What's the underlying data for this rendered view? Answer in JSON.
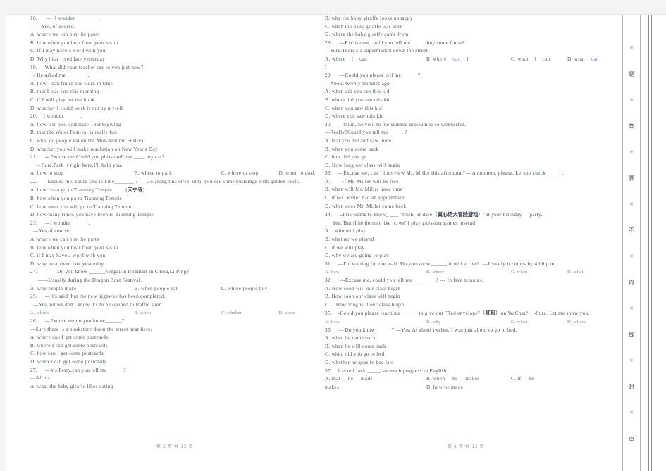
{
  "document": {
    "type": "scanned-exam-paper",
    "language": "en-zh",
    "left_page_footer": "第 3 页/共 12 页",
    "right_page_footer": "第 4 页/共 12 页"
  },
  "seal_strip": {
    "marks": [
      "※",
      "※",
      "※",
      "※",
      "※",
      "※",
      "※",
      "※"
    ],
    "characters": [
      "题",
      "答",
      "要",
      "不",
      "内",
      "线",
      "封",
      "密"
    ]
  },
  "left_page": {
    "lines": [
      {
        "kind": "q",
        "text": "18.      —  I wonder ________."
      },
      {
        "kind": "q",
        "text": "  —  Yes, of course."
      },
      {
        "kind": "opt",
        "text": "A. where we can buy the pants"
      },
      {
        "kind": "opt",
        "text": "B. how often you hear from your sister"
      },
      {
        "kind": "opt",
        "text": "C. If I may have a word with you"
      },
      {
        "kind": "opt",
        "text": "D. Why hear rived late yesterday"
      },
      {
        "kind": "q",
        "text": "19.     What did your teacher say to you just now?"
      },
      {
        "kind": "q",
        "text": "  - He asked me________."
      },
      {
        "kind": "opt",
        "text": "A. how I can finish the work in time"
      },
      {
        "kind": "opt",
        "text": "B. that I was late this morning"
      },
      {
        "kind": "opt",
        "text": "C. if I will play for the book"
      },
      {
        "kind": "opt",
        "text": "D. whether I could work it out by myself"
      },
      {
        "kind": "q",
        "text": "20.    I wonder______."
      },
      {
        "kind": "opt",
        "text": "A. how will you celebrate Thanksgiving"
      },
      {
        "kind": "opt",
        "text": "B. that the Water Festival is really fun."
      },
      {
        "kind": "opt",
        "text": "C. what do people eat on the Mid-Autumn Festival"
      },
      {
        "kind": "opt",
        "text": "D. whether you will make resolution on New Year's Day"
      },
      {
        "kind": "q",
        "text": "21.     -- Excuse me.Could you please tell me ____ my car?"
      },
      {
        "kind": "q",
        "text": "    -- Sure.Park it right here.I'll help you."
      },
      {
        "kind": "row4",
        "a": "A. how to stop",
        "b": "B. where to park",
        "c": "C. where to stop",
        "d": "D. when to park"
      },
      {
        "kind": "q",
        "text": "22.     –Excuse me, could you tell me_______ ?  -- Go along this street until you see some buildings with golden roofs."
      },
      {
        "kind": "opt_cjk",
        "text": "A. how I can go to Tianning Temple         (",
        "cjk": "天宁寺",
        "tail": ")"
      },
      {
        "kind": "opt",
        "text": "B. how often you go to Tianning Temple"
      },
      {
        "kind": "opt",
        "text": "C. how soon you will go to Tianning Temple"
      },
      {
        "kind": "opt",
        "text": "D. how many times you have been to Tianning Temple"
      },
      {
        "kind": "q",
        "text": "23.     —I wonder ______."
      },
      {
        "kind": "q",
        "text": "  —Yes,of course."
      },
      {
        "kind": "opt",
        "text": "A. where we can buy the parts"
      },
      {
        "kind": "opt",
        "text": "B. how often you hear from your sister"
      },
      {
        "kind": "opt",
        "text": "C. if I may have a word with you"
      },
      {
        "kind": "opt",
        "text": "D. why he arrived late yesterday"
      },
      {
        "kind": "q",
        "text": "24.      ——Do you know ______zongzi in tradition in China,Li Ping?"
      },
      {
        "kind": "q",
        "text": "     ——Usually during the Dragon Boat Festival."
      },
      {
        "kind": "row3",
        "a": "A. why people make",
        "b": "B. when people eat",
        "c": "C. where people buy"
      },
      {
        "kind": "q",
        "text": "25.     —It's said that the new highway has been completed."
      },
      {
        "kind": "q",
        "text": "  —Yes,but we don't know it's to be opened to traffic soon."
      },
      {
        "kind": "row4b",
        "a": "A. which",
        "b": "B. when",
        "c": "C. wheher",
        "d": "D. since"
      },
      {
        "kind": "q",
        "text": "26.     —Excuse me,do you know______?"
      },
      {
        "kind": "q",
        "text": "—Sure,there is a bookstore down the street near here."
      },
      {
        "kind": "opt",
        "text": "A. where can I get some postcards"
      },
      {
        "kind": "opt",
        "text": "B. where I can get some postcards"
      },
      {
        "kind": "opt",
        "text": "C. how can I get some postcards"
      },
      {
        "kind": "opt",
        "text": "D. when I can get some postcards"
      },
      {
        "kind": "q",
        "text": "27.     —Ms.Perry,can you tell me______?"
      },
      {
        "kind": "q",
        "text": "—Africa."
      },
      {
        "kind": "opt",
        "text": "A. what the baby giraffe likes eating"
      }
    ]
  },
  "right_page": {
    "lines": [
      {
        "kind": "opt",
        "text": "B. why the baby giraffe looks unhappy"
      },
      {
        "kind": "opt",
        "text": "C. when the baby giraffe was born"
      },
      {
        "kind": "opt",
        "text": "D. where the baby giraffe came from"
      },
      {
        "kind": "q",
        "text": "28.     —Excuse me,could you tell me           buy some fruits?"
      },
      {
        "kind": "q",
        "text": "—Sure.There's a supermarket down the street."
      },
      {
        "kind": "row4c",
        "a": "A. where",
        "a2": "I",
        "a3": "can",
        "b": "B. where",
        "b2": "can",
        "b3": "I",
        "c": "C. what",
        "c2": "I",
        "c3": "can",
        "d": "D. what",
        "d2": "can"
      },
      {
        "kind": "opt",
        "text": "I"
      },
      {
        "kind": "q",
        "text": "29.     —Could you please tell me______?"
      },
      {
        "kind": "q",
        "text": "—About twenty minutes ago."
      },
      {
        "kind": "opt",
        "text": "A. when did you see this kid"
      },
      {
        "kind": "opt",
        "text": "B. where did you see this kid"
      },
      {
        "kind": "opt",
        "text": "C. when you saw this kid"
      },
      {
        "kind": "opt",
        "text": "D. where you saw this kid"
      },
      {
        "kind": "q",
        "text": "30.    —Mum,the visit to the science museum is so wonderful."
      },
      {
        "kind": "q",
        "text": "—Really?Could you tell me______?"
      },
      {
        "kind": "opt",
        "text": "A. that you did and saw there"
      },
      {
        "kind": "opt",
        "text": "B. when you come back"
      },
      {
        "kind": "opt",
        "text": "C. how did you ge"
      },
      {
        "kind": "opt",
        "text": "D. How long our class will begin"
      },
      {
        "kind": "q",
        "text": "33.    -- Excuse me, can I interview Mr. Miller this afternoon? -- A moment, please. Let me check______."
      },
      {
        "kind": "opt",
        "text": "A.        if Mr. Miller will be free"
      },
      {
        "kind": "opt",
        "text": "B. when will Mr. Miller have time"
      },
      {
        "kind": "opt",
        "text": "C. if Mr. Miller had an appointment"
      },
      {
        "kind": "opt",
        "text": "D. when does Mr. Miller come back"
      },
      {
        "kind": "q_cjk",
        "head": "34.     Chris wants to know_ ___ \"truth, or dare（",
        "cjk": "真心话大冒险游戏",
        "tail": "）\"at your birthday     party."
      },
      {
        "kind": "q",
        "text": "     Yes. But if he doesn't like it, we'll play guessing games instead."
      },
      {
        "kind": "opt",
        "text": "A.   who will play"
      },
      {
        "kind": "opt",
        "text": "B. whether we played"
      },
      {
        "kind": "opt",
        "text": "C. if we will play"
      },
      {
        "kind": "opt",
        "text": "D. why we are going to play"
      },
      {
        "kind": "q",
        "text": "31.    —I'm waiting for the mail. Do you know______ it will arrive?  —Usually it comes by 4:00 p.m."
      },
      {
        "kind": "row4b",
        "a": "A. how",
        "b": "B. where",
        "c": "C. when",
        "d": "D. what"
      },
      {
        "kind": "q",
        "text": "32.     ---Excuse me, could you tell me ________? --- In five minutes."
      },
      {
        "kind": "opt",
        "text": "A. How soon will our class begin"
      },
      {
        "kind": "opt",
        "text": "B. How soon our class will begin"
      },
      {
        "kind": "opt",
        "text": "C.    How long will our class begin"
      },
      {
        "kind": "q_cjk",
        "head": "35.    -Could you please teach me______ to give out \"Red envelope\"（",
        "cjk": "红包",
        "tail": "）on WeChat?    -Sure. Let me show you."
      },
      {
        "kind": "row4b",
        "a": "A. how",
        "b": "B. why",
        "c": "C. when",
        "d": "D. where"
      },
      {
        "kind": "q",
        "text": "36.    — Do you know______? —Yes. At about twelve. I was just about to go to bed."
      },
      {
        "kind": "opt",
        "text": "A. when he came back"
      },
      {
        "kind": "opt",
        "text": "B. when he will come back"
      },
      {
        "kind": "opt",
        "text": "C. when did you go to bed"
      },
      {
        "kind": "opt",
        "text": "D. whether he goes to bed late"
      },
      {
        "kind": "q",
        "text": "37.    I asked Jack _____ so much progress in English."
      },
      {
        "kind": "row3b",
        "a": "A. that     he     made",
        "b": "B. when     he     makes",
        "c": "C. if     he"
      },
      {
        "kind": "row2",
        "a": "makes",
        "b": "D. how he made"
      }
    ]
  }
}
